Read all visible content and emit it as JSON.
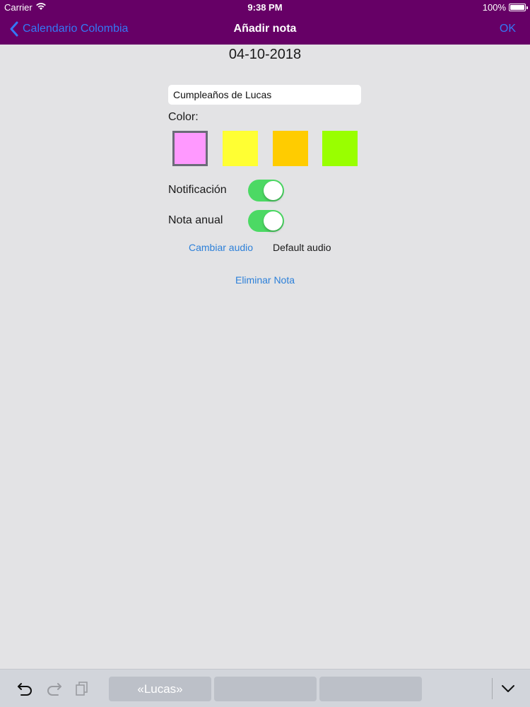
{
  "status_bar": {
    "carrier": "Carrier",
    "time": "9:38 PM",
    "battery": "100%"
  },
  "nav": {
    "back_label": "Calendario Colombia",
    "title": "Añadir nota",
    "ok_label": "OK"
  },
  "date": "04-10-2018",
  "note": {
    "value": "Cumpleaños de Lucas"
  },
  "color": {
    "label": "Color:",
    "swatches": [
      "#ff99ff",
      "#ffff33",
      "#ffcc00",
      "#99ff00"
    ],
    "selected": "#ff99ff"
  },
  "notification": {
    "label": "Notificación",
    "on": true
  },
  "annual": {
    "label": "Nota anual",
    "on": true
  },
  "audio": {
    "change_label": "Cambiar audio",
    "current": "Default audio"
  },
  "delete_label": "Eliminar Nota",
  "keyboard_bar": {
    "suggestions": [
      "«Lucas»",
      "",
      ""
    ]
  },
  "colors": {
    "nav_bg": "#660066",
    "accent": "#3478f6",
    "link": "#2d80d9",
    "toggle_on": "#4cd964"
  }
}
